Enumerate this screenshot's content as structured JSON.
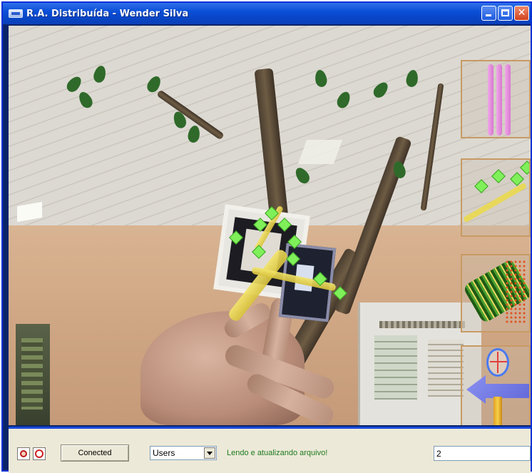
{
  "window": {
    "title": "R.A. Distribuída - Wender Silva",
    "controls": [
      "minimize-icon",
      "maximize-icon",
      "close-icon"
    ]
  },
  "camera_view": {
    "thumbnails": [
      "pink-tubes-model",
      "yellow-branch-model",
      "green-leaf-roll-model",
      "magnifier-arrow-model"
    ]
  },
  "toolbar": {
    "icons": [
      "alarm-clock-icon",
      "clock-icon"
    ],
    "connect_button_label": "Conected",
    "users_select_value": "Users",
    "status_message": "Lendo e atualizando arquivo!",
    "count_value": "2"
  },
  "colors": {
    "title_bar": "#0a4fd8",
    "toolbar_border": "#1a4adc",
    "status_text": "#1e7a1e",
    "thumbnail_border": "#c89a64"
  }
}
